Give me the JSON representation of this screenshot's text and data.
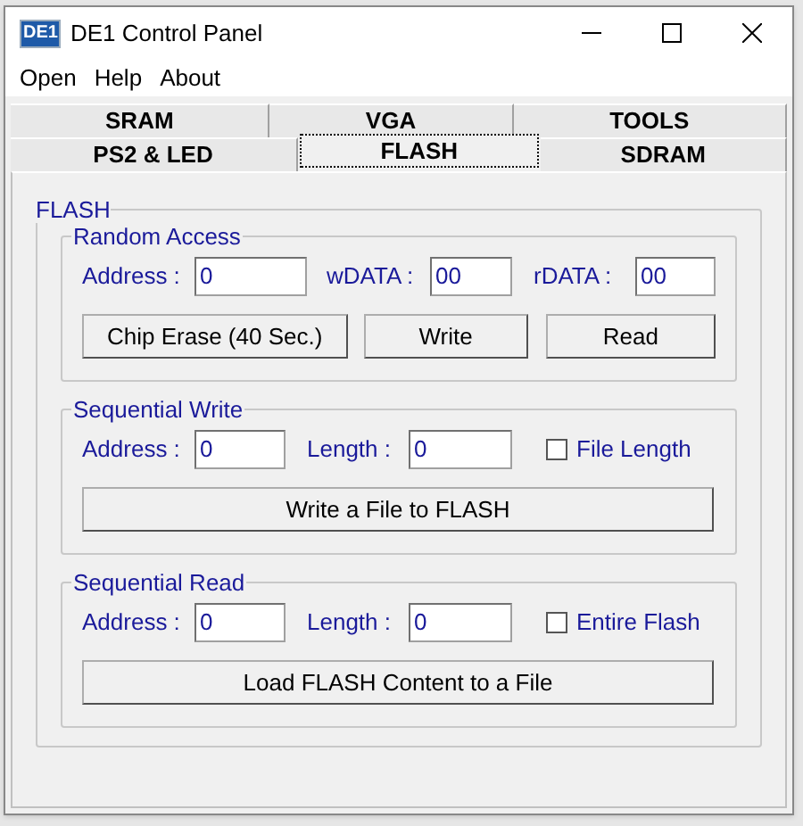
{
  "window": {
    "logo": "DE1",
    "title": "DE1 Control Panel"
  },
  "menu": [
    {
      "label": "Open"
    },
    {
      "label": "Help"
    },
    {
      "label": "About"
    }
  ],
  "tab_rows": [
    [
      {
        "label": "SRAM",
        "selected": false
      },
      {
        "label": "VGA",
        "selected": false
      },
      {
        "label": "TOOLS",
        "selected": false
      }
    ],
    [
      {
        "label": "PS2 & LED",
        "selected": false
      },
      {
        "label": "FLASH",
        "selected": true
      },
      {
        "label": "SDRAM",
        "selected": false
      }
    ]
  ],
  "panel": {
    "title": "FLASH",
    "sections": [
      {
        "kind": "random",
        "title": "Random Access",
        "fields": [
          {
            "label": "Address :",
            "value": "0"
          },
          {
            "label": "wDATA :",
            "value": "00"
          },
          {
            "label": "rDATA :",
            "value": "00"
          }
        ],
        "buttons": [
          "Chip Erase (40 Sec.)",
          "Write",
          "Read"
        ]
      },
      {
        "kind": "sequential",
        "title": "Sequential Write",
        "fields": [
          {
            "label": "Address :",
            "value": "0"
          },
          {
            "label": "Length :",
            "value": "0"
          }
        ],
        "checkbox": {
          "label": "File Length",
          "checked": false
        },
        "buttons": [
          "Write a File to FLASH"
        ]
      },
      {
        "kind": "sequential",
        "title": "Sequential Read",
        "fields": [
          {
            "label": "Address :",
            "value": "0"
          },
          {
            "label": "Length :",
            "value": "0"
          }
        ],
        "checkbox": {
          "label": "Entire Flash",
          "checked": false
        },
        "buttons": [
          "Load FLASH Content to a File"
        ]
      }
    ]
  }
}
